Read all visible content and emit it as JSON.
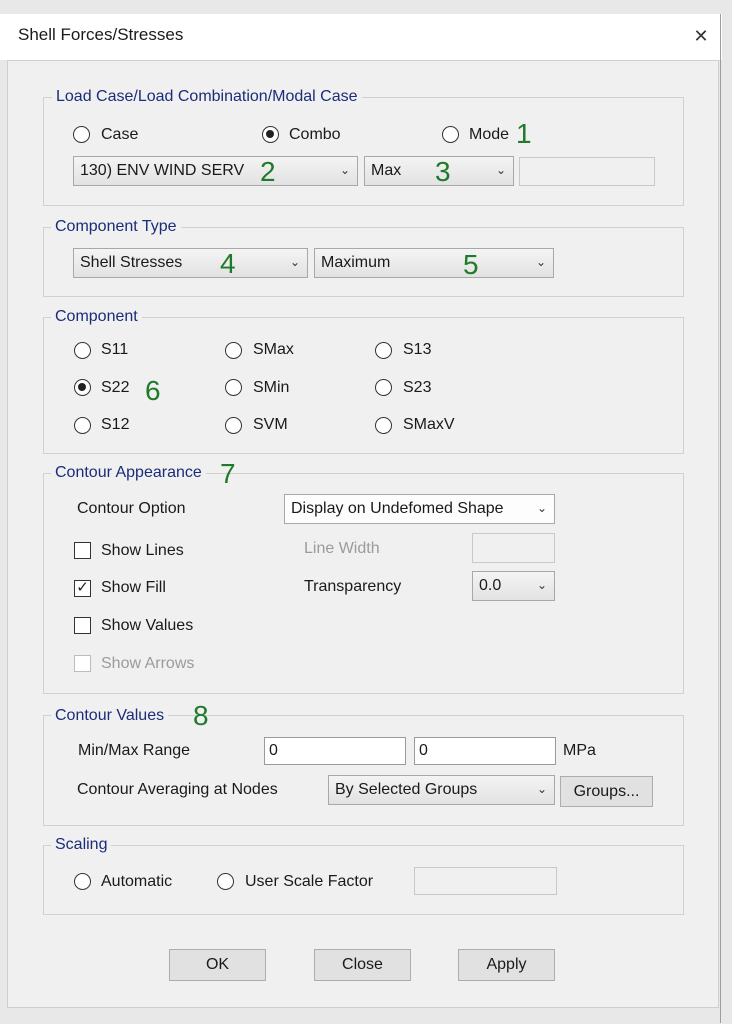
{
  "window": {
    "title": "Shell Forces/Stresses",
    "close_glyph": "✕"
  },
  "load_case": {
    "legend": "Load Case/Load Combination/Modal Case",
    "radios": [
      {
        "label": "Case",
        "checked": false
      },
      {
        "label": "Combo",
        "checked": true
      },
      {
        "label": "Mode",
        "checked": false
      }
    ],
    "combo_value": "130) ENV WIND SERV",
    "step_value": "Max",
    "extra_field": ""
  },
  "component_type": {
    "legend": "Component Type",
    "type_value": "Shell Stresses",
    "sub_value": "Maximum"
  },
  "component": {
    "legend": "Component",
    "options": [
      {
        "label": "S11",
        "checked": false
      },
      {
        "label": "SMax",
        "checked": false
      },
      {
        "label": "S13",
        "checked": false
      },
      {
        "label": "S22",
        "checked": true
      },
      {
        "label": "SMin",
        "checked": false
      },
      {
        "label": "S23",
        "checked": false
      },
      {
        "label": "S12",
        "checked": false
      },
      {
        "label": "SVM",
        "checked": false
      },
      {
        "label": "SMaxV",
        "checked": false
      }
    ]
  },
  "contour_appearance": {
    "legend": "Contour Appearance",
    "option_label": "Contour Option",
    "option_value": "Display on Undefomed Shape",
    "checkboxes": [
      {
        "label": "Show Lines",
        "checked": false,
        "disabled": false
      },
      {
        "label": "Show Fill",
        "checked": true,
        "disabled": false
      },
      {
        "label": "Show Values",
        "checked": false,
        "disabled": false
      },
      {
        "label": "Show Arrows",
        "checked": false,
        "disabled": true
      }
    ],
    "line_width_label": "Line Width",
    "line_width_value": "",
    "transparency_label": "Transparency",
    "transparency_value": "0.0"
  },
  "contour_values": {
    "legend": "Contour Values",
    "range_label": "Min/Max Range",
    "min_value": "0",
    "max_value": "0",
    "unit": "MPa",
    "averaging_label": "Contour Averaging at Nodes",
    "averaging_value": "By Selected Groups",
    "groups_button": "Groups..."
  },
  "scaling": {
    "legend": "Scaling",
    "radios": [
      {
        "label": "Automatic",
        "checked": false
      },
      {
        "label": "User Scale Factor",
        "checked": false
      }
    ],
    "scale_field": ""
  },
  "buttons": {
    "ok": "OK",
    "close": "Close",
    "apply": "Apply"
  },
  "annotations": [
    "1",
    "2",
    "3",
    "4",
    "5",
    "6",
    "7",
    "8"
  ],
  "colors": {
    "legend": "#1a2c7a",
    "annotation": "#1f7a2a"
  }
}
